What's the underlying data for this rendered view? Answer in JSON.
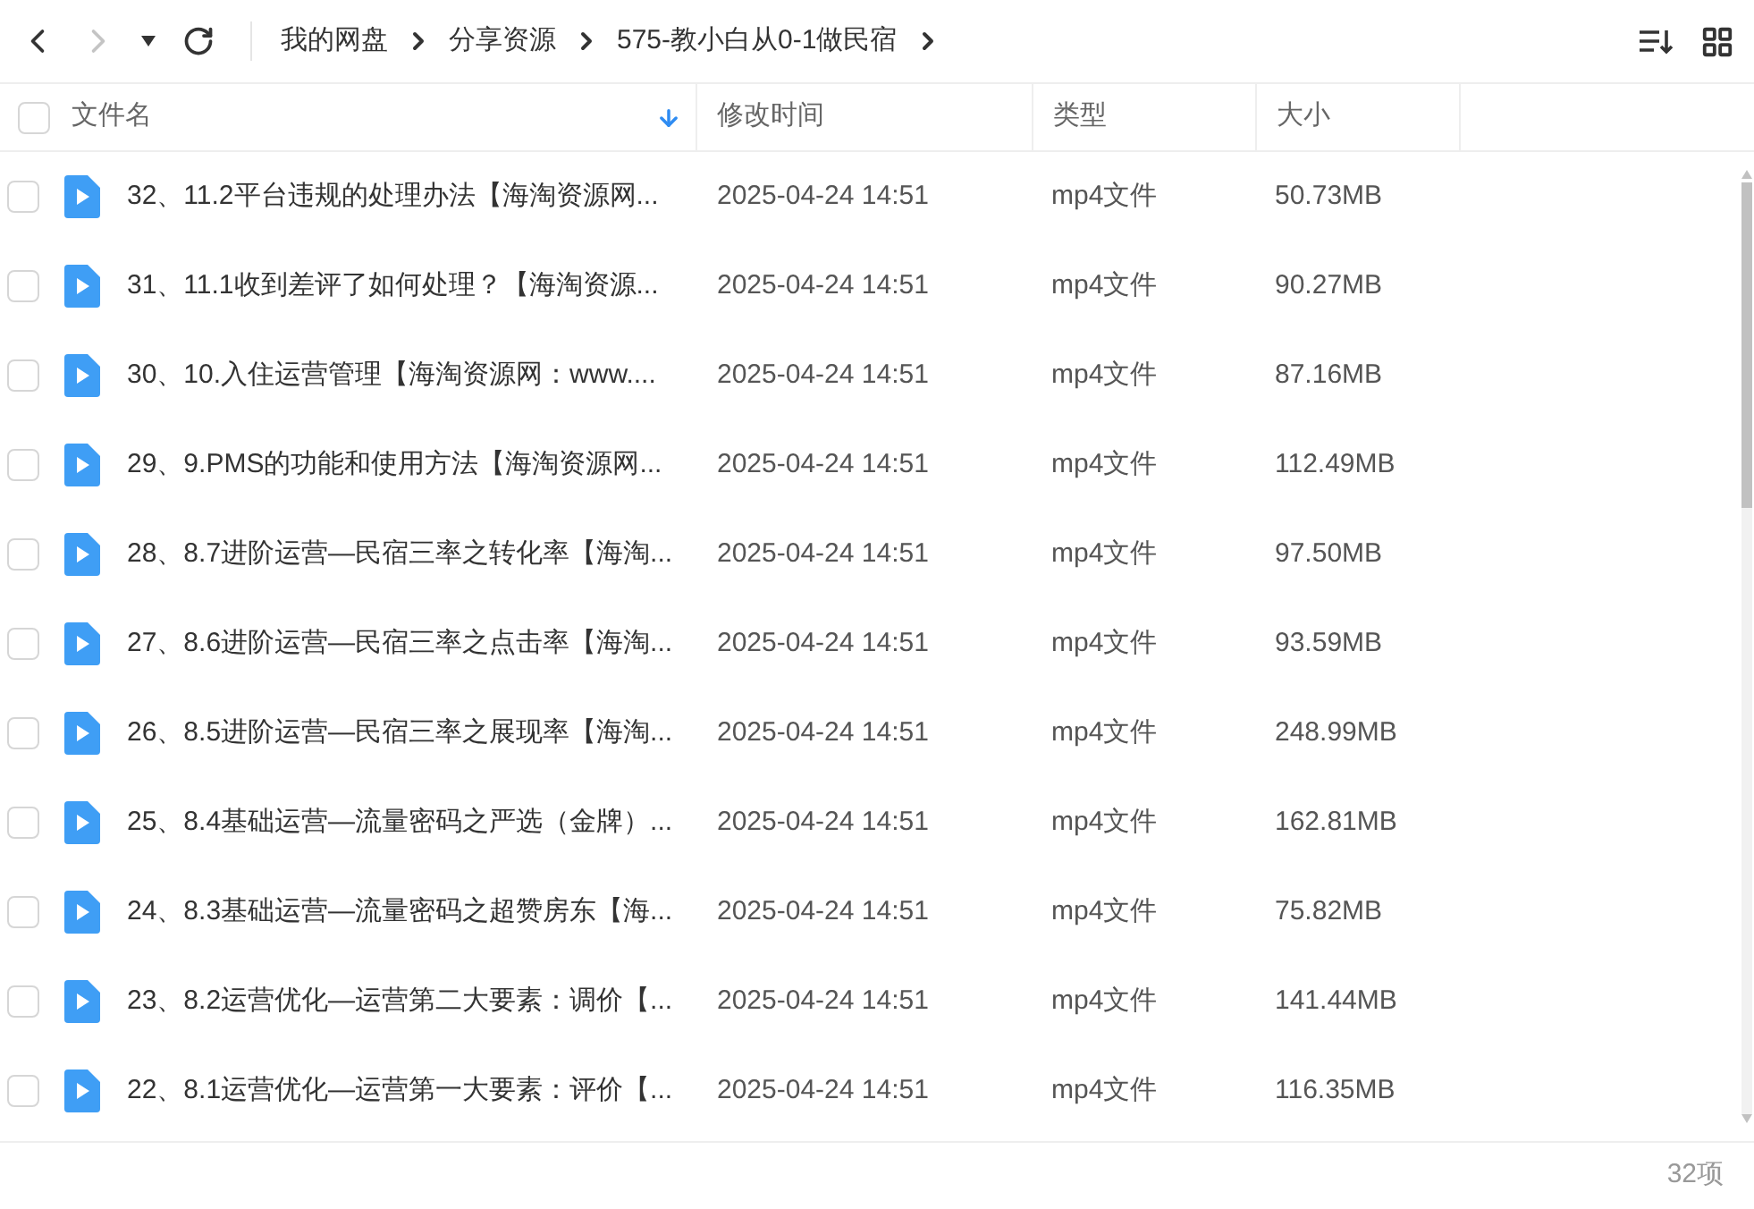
{
  "toolbar": {
    "nav": [
      {
        "kind": "back",
        "disabled": false
      },
      {
        "kind": "forward",
        "disabled": true
      },
      {
        "kind": "history",
        "disabled": false
      },
      {
        "kind": "refresh",
        "disabled": false
      }
    ],
    "breadcrumbs": [
      "我的网盘",
      "分享资源",
      "575-教小白从0-1做民宿"
    ]
  },
  "table": {
    "select_all": {
      "checked": false
    },
    "columns": [
      {
        "label": "文件名",
        "sorted": true
      },
      {
        "label": "修改时间",
        "sorted": false
      },
      {
        "label": "类型",
        "sorted": false
      },
      {
        "label": "大小",
        "sorted": false
      }
    ],
    "rows": [
      {
        "name": "32、11.2平台违规的处理办法【海淘资源网...",
        "modified": "2025-04-24 14:51",
        "type": "mp4文件",
        "size": "50.73MB",
        "checked": false
      },
      {
        "name": "31、11.1收到差评了如何处理？【海淘资源...",
        "modified": "2025-04-24 14:51",
        "type": "mp4文件",
        "size": "90.27MB",
        "checked": false
      },
      {
        "name": "30、10.入住运营管理【海淘资源网：www....",
        "modified": "2025-04-24 14:51",
        "type": "mp4文件",
        "size": "87.16MB",
        "checked": false
      },
      {
        "name": "29、9.PMS的功能和使用方法【海淘资源网...",
        "modified": "2025-04-24 14:51",
        "type": "mp4文件",
        "size": "112.49MB",
        "checked": false
      },
      {
        "name": "28、8.7进阶运营—民宿三率之转化率【海淘...",
        "modified": "2025-04-24 14:51",
        "type": "mp4文件",
        "size": "97.50MB",
        "checked": false
      },
      {
        "name": "27、8.6进阶运营—民宿三率之点击率【海淘...",
        "modified": "2025-04-24 14:51",
        "type": "mp4文件",
        "size": "93.59MB",
        "checked": false
      },
      {
        "name": "26、8.5进阶运营—民宿三率之展现率【海淘...",
        "modified": "2025-04-24 14:51",
        "type": "mp4文件",
        "size": "248.99MB",
        "checked": false
      },
      {
        "name": "25、8.4基础运营—流量密码之严选（金牌）...",
        "modified": "2025-04-24 14:51",
        "type": "mp4文件",
        "size": "162.81MB",
        "checked": false
      },
      {
        "name": "24、8.3基础运营—流量密码之超赞房东【海...",
        "modified": "2025-04-24 14:51",
        "type": "mp4文件",
        "size": "75.82MB",
        "checked": false
      },
      {
        "name": "23、8.2运营优化—运营第二大要素：调价【...",
        "modified": "2025-04-24 14:51",
        "type": "mp4文件",
        "size": "141.44MB",
        "checked": false
      },
      {
        "name": "22、8.1运营优化—运营第一大要素：评价【...",
        "modified": "2025-04-24 14:51",
        "type": "mp4文件",
        "size": "116.35MB",
        "checked": false
      }
    ]
  },
  "status_bar": {
    "count": "32项"
  }
}
